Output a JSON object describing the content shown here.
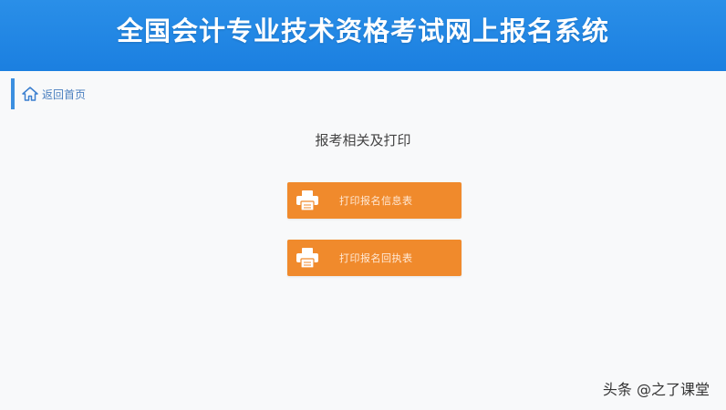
{
  "header": {
    "title": "全国会计专业技术资格考试网上报名系统",
    "background_color": "#1b7fe0"
  },
  "breadcrumb": {
    "icon": "home-icon",
    "label": "返回首页"
  },
  "main": {
    "section_title": "报考相关及打印",
    "buttons": [
      {
        "label": "打印报名信息表",
        "icon": "printer-icon"
      },
      {
        "label": "打印报名回执表",
        "icon": "printer-icon"
      }
    ],
    "button_color": "#f08a2c"
  },
  "watermark": "头条 @之了课堂"
}
